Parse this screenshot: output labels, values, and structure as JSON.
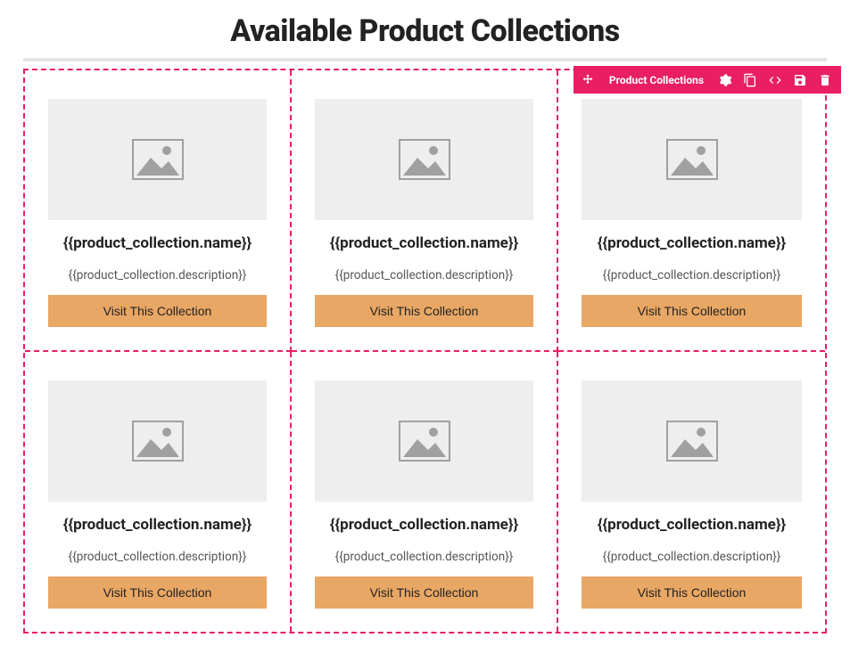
{
  "header": {
    "title": "Available Product Collections"
  },
  "toolbar": {
    "label": "Product Collections",
    "icons": [
      "move",
      "settings",
      "copy",
      "code",
      "save",
      "delete"
    ]
  },
  "cards": [
    {
      "name": "{{product_collection.name}}",
      "description": "{{product_collection.description}}",
      "button": "Visit This Collection"
    },
    {
      "name": "{{product_collection.name}}",
      "description": "{{product_collection.description}}",
      "button": "Visit This Collection"
    },
    {
      "name": "{{product_collection.name}}",
      "description": "{{product_collection.description}}",
      "button": "Visit This Collection"
    },
    {
      "name": "{{product_collection.name}}",
      "description": "{{product_collection.description}}",
      "button": "Visit This Collection"
    },
    {
      "name": "{{product_collection.name}}",
      "description": "{{product_collection.description}}",
      "button": "Visit This Collection"
    },
    {
      "name": "{{product_collection.name}}",
      "description": "{{product_collection.description}}",
      "button": "Visit This Collection"
    }
  ],
  "colors": {
    "accent": "#e91e63",
    "button": "#e8a764",
    "placeholder_bg": "#eeeeee",
    "placeholder_fg": "#a0a0a0"
  }
}
